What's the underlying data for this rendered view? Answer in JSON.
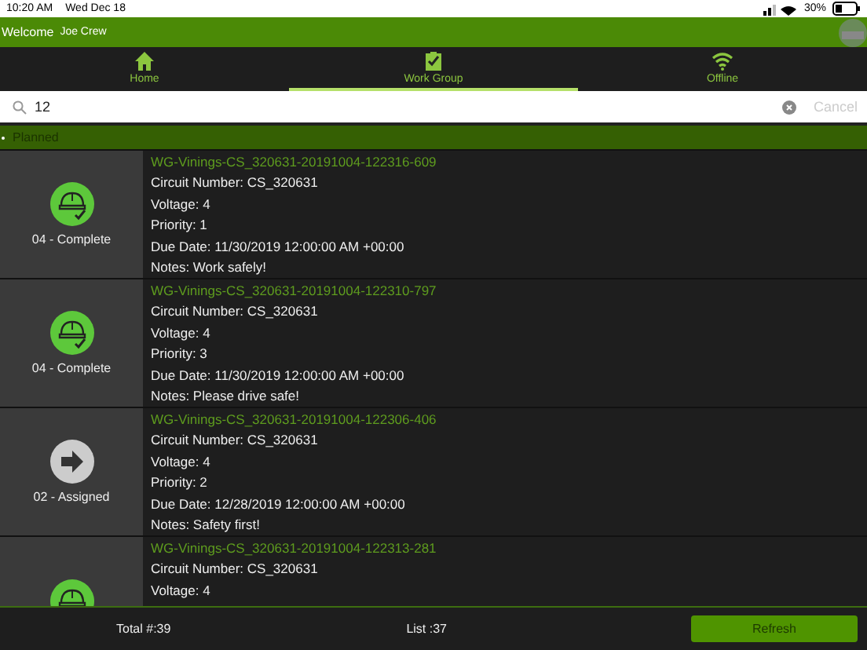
{
  "status_bar": {
    "time": "10:20 AM",
    "date": "Wed Dec 18",
    "battery": "30%"
  },
  "header": {
    "welcome": "Welcome",
    "user": "Joe Crew"
  },
  "tabs": [
    {
      "label": "Home",
      "kind": "home",
      "selected": false
    },
    {
      "label": "Work Group",
      "kind": "group",
      "selected": true
    },
    {
      "label": "Offline",
      "kind": "offline",
      "selected": false
    }
  ],
  "search": {
    "value": "12",
    "cancel": "Cancel"
  },
  "section": {
    "title": "Planned"
  },
  "items": [
    {
      "kind": "complete",
      "status": "04 - Complete",
      "title": "WG-Vinings-CS_320631-20191004-122316-609",
      "lines": [
        "Circuit Number: CS_320631",
        "Voltage: 4",
        "Priority: 1",
        "Due Date: 11/30/2019 12:00:00 AM +00:00",
        "Notes: Work safely!"
      ]
    },
    {
      "kind": "complete",
      "status": "04 - Complete",
      "title": "WG-Vinings-CS_320631-20191004-122310-797",
      "lines": [
        "Circuit Number: CS_320631",
        "Voltage: 4",
        "Priority: 3",
        "Due Date: 11/30/2019 12:00:00 AM +00:00",
        "Notes: Please drive safe!"
      ]
    },
    {
      "kind": "assigned",
      "status": "02 - Assigned",
      "title": "WG-Vinings-CS_320631-20191004-122306-406",
      "lines": [
        "Circuit Number: CS_320631",
        "Voltage: 4",
        "Priority: 2",
        "Due Date: 12/28/2019 12:00:00 AM +00:00",
        "Notes: Safety first!"
      ]
    },
    {
      "kind": "complete",
      "title": "WG-Vinings-CS_320631-20191004-122313-281",
      "lines": [
        "Circuit Number: CS_320631",
        "Voltage: 4"
      ]
    }
  ],
  "footer": {
    "total": "Total #:39",
    "list": "List :37",
    "refresh": "Refresh"
  }
}
